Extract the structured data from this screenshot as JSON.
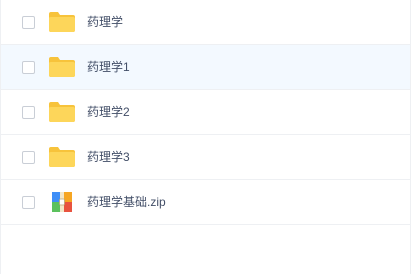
{
  "files": [
    {
      "name": "药理学",
      "type": "folder",
      "icon": "folder-icon"
    },
    {
      "name": "药理学1",
      "type": "folder",
      "icon": "folder-icon"
    },
    {
      "name": "药理学2",
      "type": "folder",
      "icon": "folder-icon"
    },
    {
      "name": "药理学3",
      "type": "folder",
      "icon": "folder-icon"
    },
    {
      "name": "药理学基础.zip",
      "type": "archive",
      "icon": "zip-icon"
    }
  ],
  "colors": {
    "folder": "#fdcf4f",
    "folder_tab": "#f7c33b",
    "highlight_row": "#f3f9ff",
    "zip_red": "#e8533f",
    "zip_green": "#5bc15d",
    "zip_blue": "#3e8ef7",
    "zip_orange": "#f6a623"
  }
}
